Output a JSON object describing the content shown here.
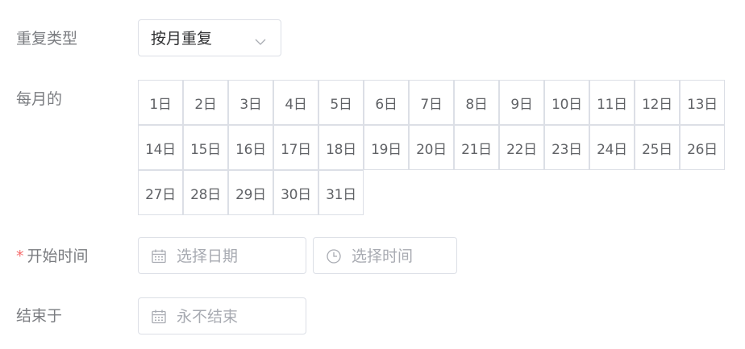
{
  "form": {
    "repeat_type": {
      "label": "重复类型",
      "value": "按月重复",
      "arrow_icon": "chevron-down-icon"
    },
    "monthly_days": {
      "label": "每月的",
      "days": [
        "1日",
        "2日",
        "3日",
        "4日",
        "5日",
        "6日",
        "7日",
        "8日",
        "9日",
        "10日",
        "11日",
        "12日",
        "13日",
        "14日",
        "15日",
        "16日",
        "17日",
        "18日",
        "19日",
        "20日",
        "21日",
        "22日",
        "23日",
        "24日",
        "25日",
        "26日",
        "27日",
        "28日",
        "29日",
        "30日",
        "31日"
      ]
    },
    "start_time": {
      "required_mark": "*",
      "label": "开始时间",
      "date_placeholder": "选择日期",
      "date_icon": "calendar-icon",
      "time_placeholder": "选择时间",
      "time_icon": "clock-icon"
    },
    "end": {
      "label": "结束于",
      "placeholder": "永不结束",
      "icon": "calendar-icon"
    }
  },
  "colors": {
    "label": "#7a7c80",
    "required": "#f56c6c",
    "border": "#dcdfe6",
    "placeholder": "#a8abb2",
    "text": "#303133"
  }
}
